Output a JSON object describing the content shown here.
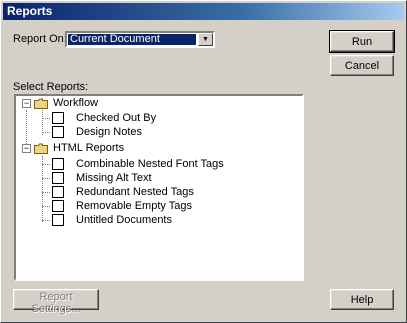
{
  "window": {
    "title": "Reports"
  },
  "report_on": {
    "label": "Report On:",
    "value": "Current Document"
  },
  "select_reports_label": "Select Reports:",
  "tree": {
    "groups": [
      {
        "label": "Workflow",
        "items": [
          "Checked Out By",
          "Design Notes"
        ]
      },
      {
        "label": "HTML Reports",
        "items": [
          "Combinable Nested Font Tags",
          "Missing Alt Text",
          "Redundant Nested Tags",
          "Removable Empty Tags",
          "Untitled Documents"
        ]
      }
    ]
  },
  "buttons": {
    "run": "Run",
    "cancel": "Cancel",
    "report_settings": "Report Settings...",
    "help": "Help"
  },
  "icons": {
    "expander": "minus-box-icon",
    "folder": "folder-icon",
    "combo_arrow": "chevron-down-icon"
  }
}
